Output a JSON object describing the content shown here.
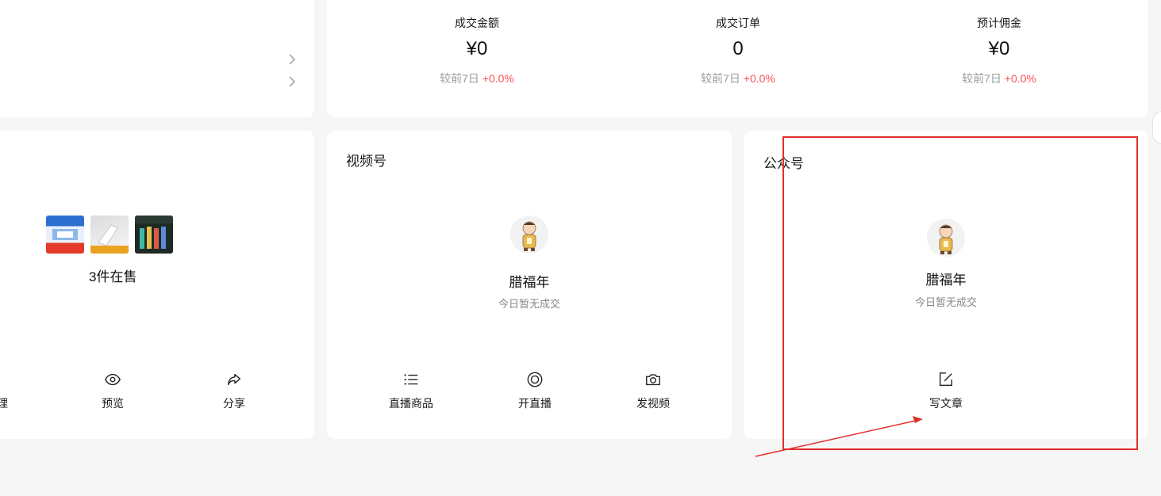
{
  "stats": [
    {
      "label": "成交金额",
      "value": "¥0",
      "compare_prefix": "较前7日",
      "delta": "+0.0%"
    },
    {
      "label": "成交订单",
      "value": "0",
      "compare_prefix": "较前7日",
      "delta": "+0.0%"
    },
    {
      "label": "预计佣金",
      "value": "¥0",
      "compare_prefix": "较前7日",
      "delta": "+0.0%"
    }
  ],
  "shop": {
    "count_text": "3件在售",
    "actions": [
      {
        "label": "理",
        "icon": "manage-icon"
      },
      {
        "label": "预览",
        "icon": "eye-icon"
      },
      {
        "label": "分享",
        "icon": "share-icon"
      }
    ]
  },
  "channels": {
    "title": "视频号",
    "name": "腊福年",
    "status": "今日暂无成交",
    "actions": [
      {
        "label": "直播商品",
        "icon": "list-icon"
      },
      {
        "label": "开直播",
        "icon": "live-icon"
      },
      {
        "label": "发视频",
        "icon": "camera-icon"
      }
    ]
  },
  "official": {
    "title": "公众号",
    "name": "腊福年",
    "status": "今日暂无成交",
    "actions": [
      {
        "label": "写文章",
        "icon": "edit-icon"
      }
    ]
  },
  "colors": {
    "accent_red": "#fa5151",
    "annotation_red": "#e0302a",
    "background": "#f6f6f6"
  }
}
